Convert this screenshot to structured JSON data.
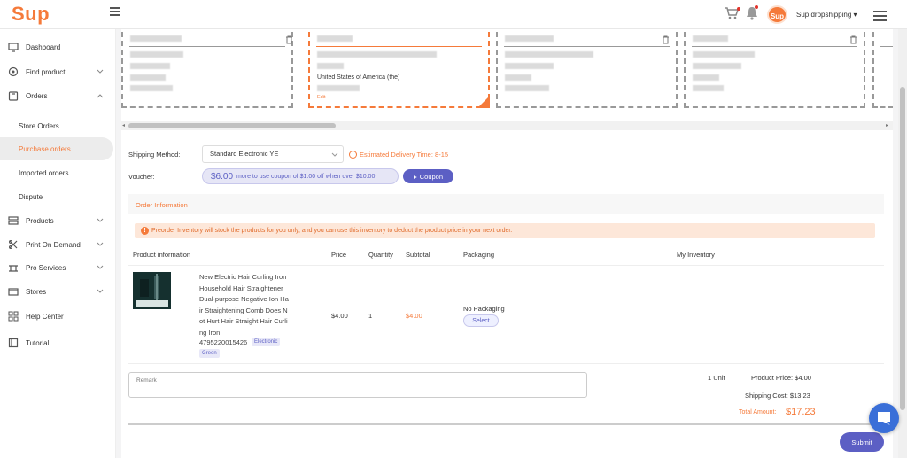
{
  "header": {
    "logo": "Sup",
    "avatar_text": "Sup",
    "username": "Sup dropshipping",
    "icons": [
      "menu-toggle-icon",
      "cart-icon",
      "bell-icon",
      "hamburger-icon"
    ]
  },
  "sidebar": {
    "items": [
      {
        "label": "Dashboard",
        "icon": "monitor-icon"
      },
      {
        "label": "Find product",
        "icon": "search-icon"
      },
      {
        "label": "Orders",
        "icon": "orders-icon"
      },
      {
        "label": "Products",
        "icon": "products-icon"
      },
      {
        "label": "Print On Demand",
        "icon": "print-icon"
      },
      {
        "label": "Pro Services",
        "icon": "services-icon"
      },
      {
        "label": "Stores",
        "icon": "store-icon"
      },
      {
        "label": "Help Center",
        "icon": "help-icon"
      },
      {
        "label": "Tutorial",
        "icon": "tutorial-icon"
      }
    ],
    "sub_items": [
      {
        "label": "Store Orders"
      },
      {
        "label": "Purchase orders",
        "active": true
      },
      {
        "label": "Imported orders"
      },
      {
        "label": "Dispute"
      }
    ]
  },
  "address_cards": {
    "selected_country": "United States of America (the)",
    "edit_label": "Edit"
  },
  "shipping": {
    "method_label": "Shipping Method:",
    "method_value": "Standard Electronic YE",
    "estimated": "Estimated Delivery Time: 8-15",
    "voucher_label": "Voucher:",
    "voucher_amount": "$6.00",
    "voucher_text": "more to use coupon of $1.00 off when over $10.00",
    "coupon_button": "Coupon"
  },
  "order": {
    "section_title": "Order Information",
    "notice": "Preorder Inventory will stock the products for you only, and you can use this inventory to deduct the product price in your next order.",
    "columns": [
      "Product information",
      "Price",
      "Quantity",
      "Subtotal",
      "Packaging",
      "My Inventory"
    ],
    "product": {
      "title": "New Electric Hair Curling Iron Household Hair Straightener Dual-purpose Negative Ion Hair Straightening Comb Does Not Hurt Hair Straight Hair Curling Iron",
      "sku": "4795220015426",
      "tags": [
        "Electronic",
        "Green"
      ],
      "price": "$4.00",
      "quantity": "1",
      "subtotal": "$4.00",
      "packaging": "No Packaging",
      "packaging_button": "Select"
    }
  },
  "summary": {
    "remark_placeholder": "Remark",
    "units": "1 Unit",
    "product_price": "Product Price: $4.00",
    "shipping_cost": "Shipping Cost: $13.23",
    "total_label": "Total Amount:",
    "total_value": "$17.23",
    "submit": "Submit"
  },
  "colors": {
    "brand": "#f57a3a",
    "accent": "#5c5fc4"
  }
}
